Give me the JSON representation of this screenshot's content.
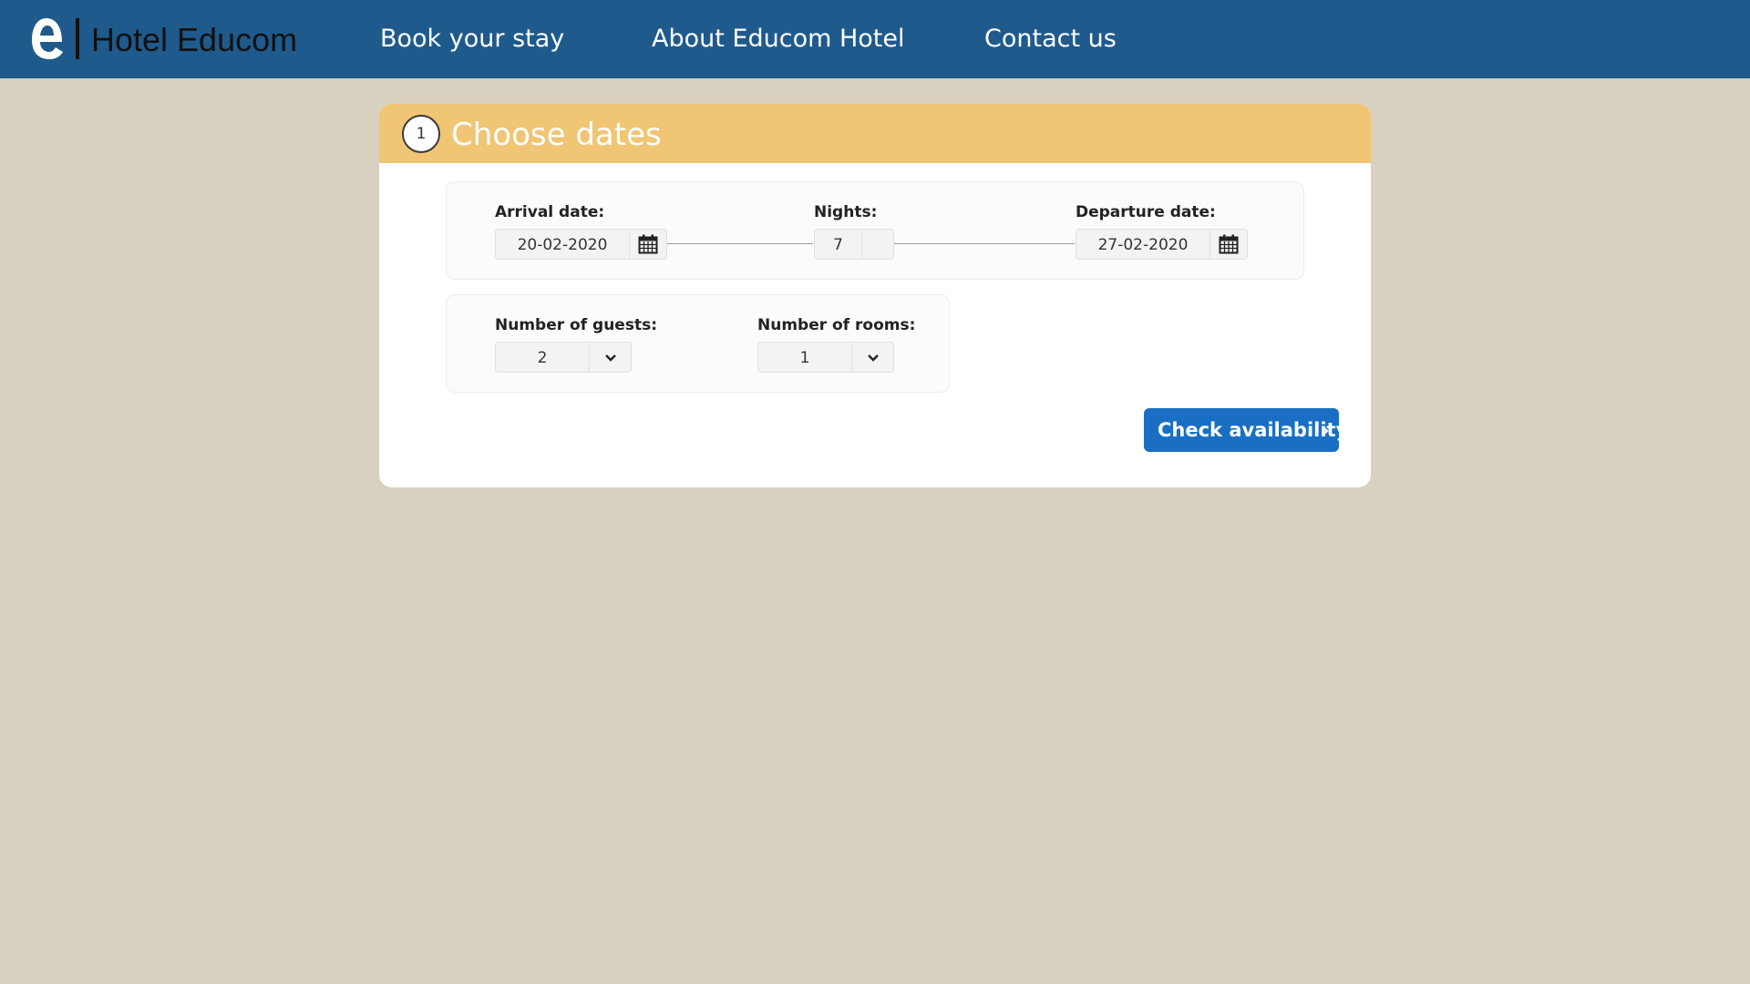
{
  "header": {
    "logo_text": "Hotel Educom",
    "nav": [
      {
        "label": "Book your stay"
      },
      {
        "label": "About Educom Hotel"
      },
      {
        "label": "Contact us"
      }
    ],
    "background_color": "#1f5a8c"
  },
  "step": {
    "number": "1",
    "title": "Choose dates",
    "header_color": "#f0c574"
  },
  "dates": {
    "arrival_label": "Arrival date:",
    "arrival_value": "20-02-2020",
    "nights_label": "Nights:",
    "nights_value": "7",
    "departure_label": "Departure date:",
    "departure_value": "27-02-2020",
    "calendar_icon": "calendar-icon"
  },
  "occupancy": {
    "guests_label": "Number of guests:",
    "guests_value": "2",
    "rooms_label": "Number of rooms:",
    "rooms_value": "1",
    "dropdown_icon": "chevron-down-icon"
  },
  "actions": {
    "check_label": "Check availability",
    "button_color": "#1a6fc4",
    "button_icon": "chevron-right-icon"
  }
}
